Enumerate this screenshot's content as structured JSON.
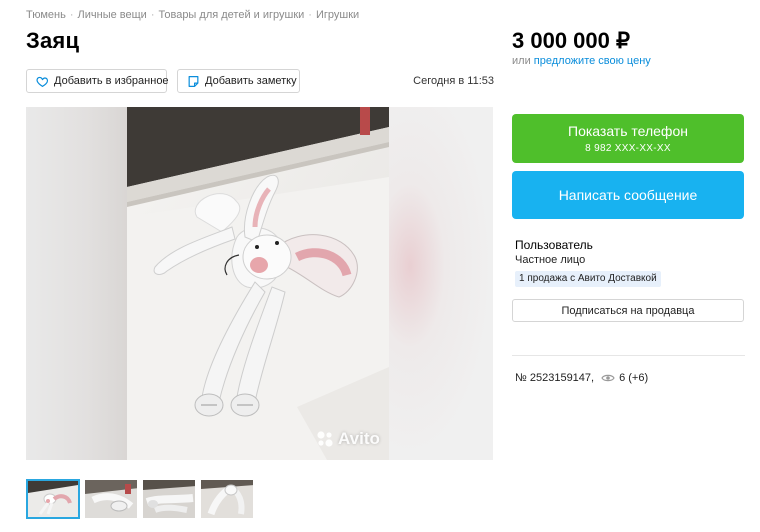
{
  "breadcrumb": [
    "Тюмень",
    "Личные вещи",
    "Товары для детей и игрушки",
    "Игрушки"
  ],
  "title": "Заяц",
  "price": {
    "value": "3 000 000 ₽",
    "or_text": "или",
    "offer_link": "предложите свою цену"
  },
  "actions": {
    "favorite_label": "Добавить в избранное",
    "note_label": "Добавить заметку"
  },
  "date": "Сегодня в 11:53",
  "gallery": {
    "watermark": "Avito",
    "thumbnails_count": 4,
    "active_thumbnail": 1
  },
  "contact": {
    "phone_label": "Показать телефон",
    "phone_masked": "8 982 XXX-XX-XX",
    "message_label": "Написать сообщение",
    "phone_color": "#4fbf2b",
    "message_color": "#18b2f0"
  },
  "seller": {
    "name": "Пользователь",
    "type": "Частное лицо",
    "badge": "1 продажа с Авито Доставкой",
    "subscribe_label": "Подписаться на продавца"
  },
  "meta": {
    "item_number": "№ 2523159147,",
    "views": "6 (+6)"
  },
  "icons": {
    "favorite": "heart-icon",
    "note": "note-icon",
    "views": "eye-icon",
    "watermark": "avito-logo-icon"
  }
}
